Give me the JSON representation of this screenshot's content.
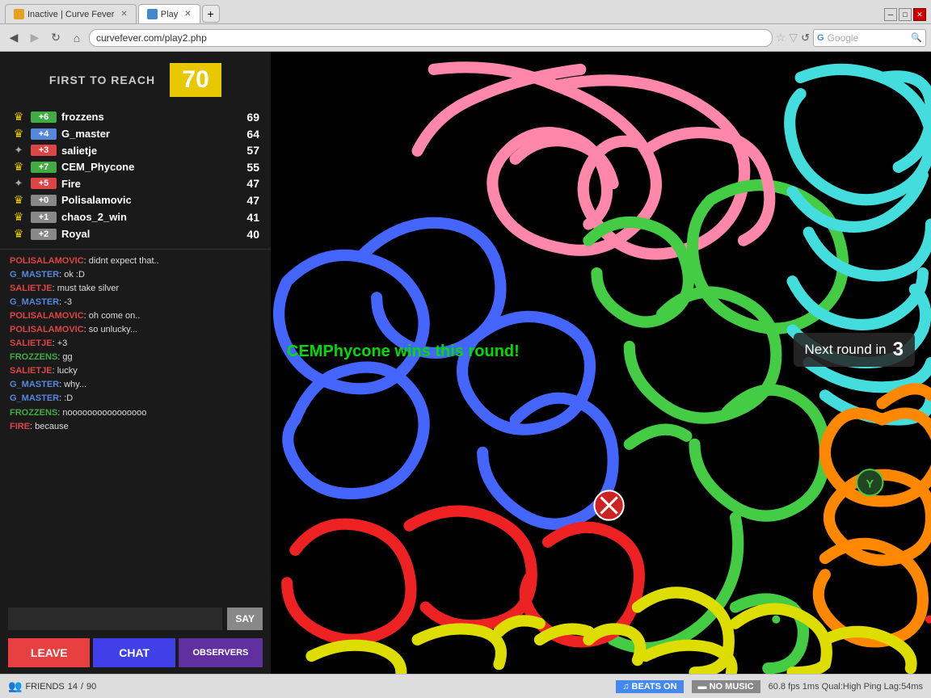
{
  "browser": {
    "tabs": [
      {
        "label": "Inactive | Curve Fever",
        "active": false,
        "icon_color": "#e8a020"
      },
      {
        "label": "Play",
        "active": true,
        "icon_color": "#4488cc"
      }
    ],
    "address": "curvefever.com/play2.php",
    "search_placeholder": "Google"
  },
  "game": {
    "first_to_reach_label": "FIRST TO REACH",
    "target_score": "70",
    "round_winner_msg": "CEMPhycone wins this round!",
    "next_round_label": "Next round in",
    "next_round_num": "3"
  },
  "players": [
    {
      "icon": "crown",
      "badge": "+6",
      "badge_color": "#44aa44",
      "name": "frozzens",
      "score": "69"
    },
    {
      "icon": "crown",
      "badge": "+4",
      "badge_color": "#5588dd",
      "name": "G_master",
      "score": "64"
    },
    {
      "icon": "feather",
      "badge": "+3",
      "badge_color": "#dd4444",
      "name": "salietje",
      "score": "57"
    },
    {
      "icon": "crown",
      "badge": "+7",
      "badge_color": "#44aa44",
      "name": "CEM_Phycone",
      "score": "55"
    },
    {
      "icon": "feather",
      "badge": "+5",
      "badge_color": "#dd4444",
      "name": "Fire",
      "score": "47"
    },
    {
      "icon": "crown",
      "badge": "+0",
      "badge_color": "#888888",
      "name": "Polisalamovic",
      "score": "47"
    },
    {
      "icon": "crown",
      "badge": "+1",
      "badge_color": "#888888",
      "name": "chaos_2_win",
      "score": "41"
    },
    {
      "icon": "crown",
      "badge": "+2",
      "badge_color": "#888888",
      "name": "Royal",
      "score": "40"
    }
  ],
  "chat": [
    {
      "name": "POLISALAMOVIC",
      "name_color": "#dd4444",
      "msg": ": didnt expect that.."
    },
    {
      "name": "G_MASTER",
      "name_color": "#5588dd",
      "msg": ": ok :D"
    },
    {
      "name": "SALIETJE",
      "name_color": "#dd4444",
      "msg": ": must take silver"
    },
    {
      "name": "G_MASTER",
      "name_color": "#5588dd",
      "msg": ": -3"
    },
    {
      "name": "POLISALAMOVIC",
      "name_color": "#dd4444",
      "msg": ": oh come on.."
    },
    {
      "name": "POLISALAMOVIC",
      "name_color": "#dd4444",
      "msg": ": so unlucky..."
    },
    {
      "name": "SALIETJE",
      "name_color": "#dd4444",
      "msg": ": +3"
    },
    {
      "name": "FROZZENS",
      "name_color": "#44aa44",
      "msg": ": gg"
    },
    {
      "name": "SALIETJE",
      "name_color": "#dd4444",
      "msg": ": lucky"
    },
    {
      "name": "G_MASTER",
      "name_color": "#5588dd",
      "msg": ": why..."
    },
    {
      "name": "G_MASTER",
      "name_color": "#5588dd",
      "msg": ": :D"
    },
    {
      "name": "FROZZENS",
      "name_color": "#44aa44",
      "msg": ": noooooooooooooooo"
    },
    {
      "name": "FIRE",
      "name_color": "#dd4444",
      "msg": ": because"
    }
  ],
  "buttons": {
    "say": "SAY",
    "leave": "LEAVE",
    "chat": "CHAT",
    "observers": "OBSERVERS"
  },
  "statusbar": {
    "friends_label": "FRIENDS",
    "friends_count": "14",
    "friends_total": "90",
    "beats_label": "BEATS ON",
    "nomusic_label": "NO MUSIC",
    "fps_info": "60.8 fps 1ms Qual:High Ping Lag:54ms"
  }
}
